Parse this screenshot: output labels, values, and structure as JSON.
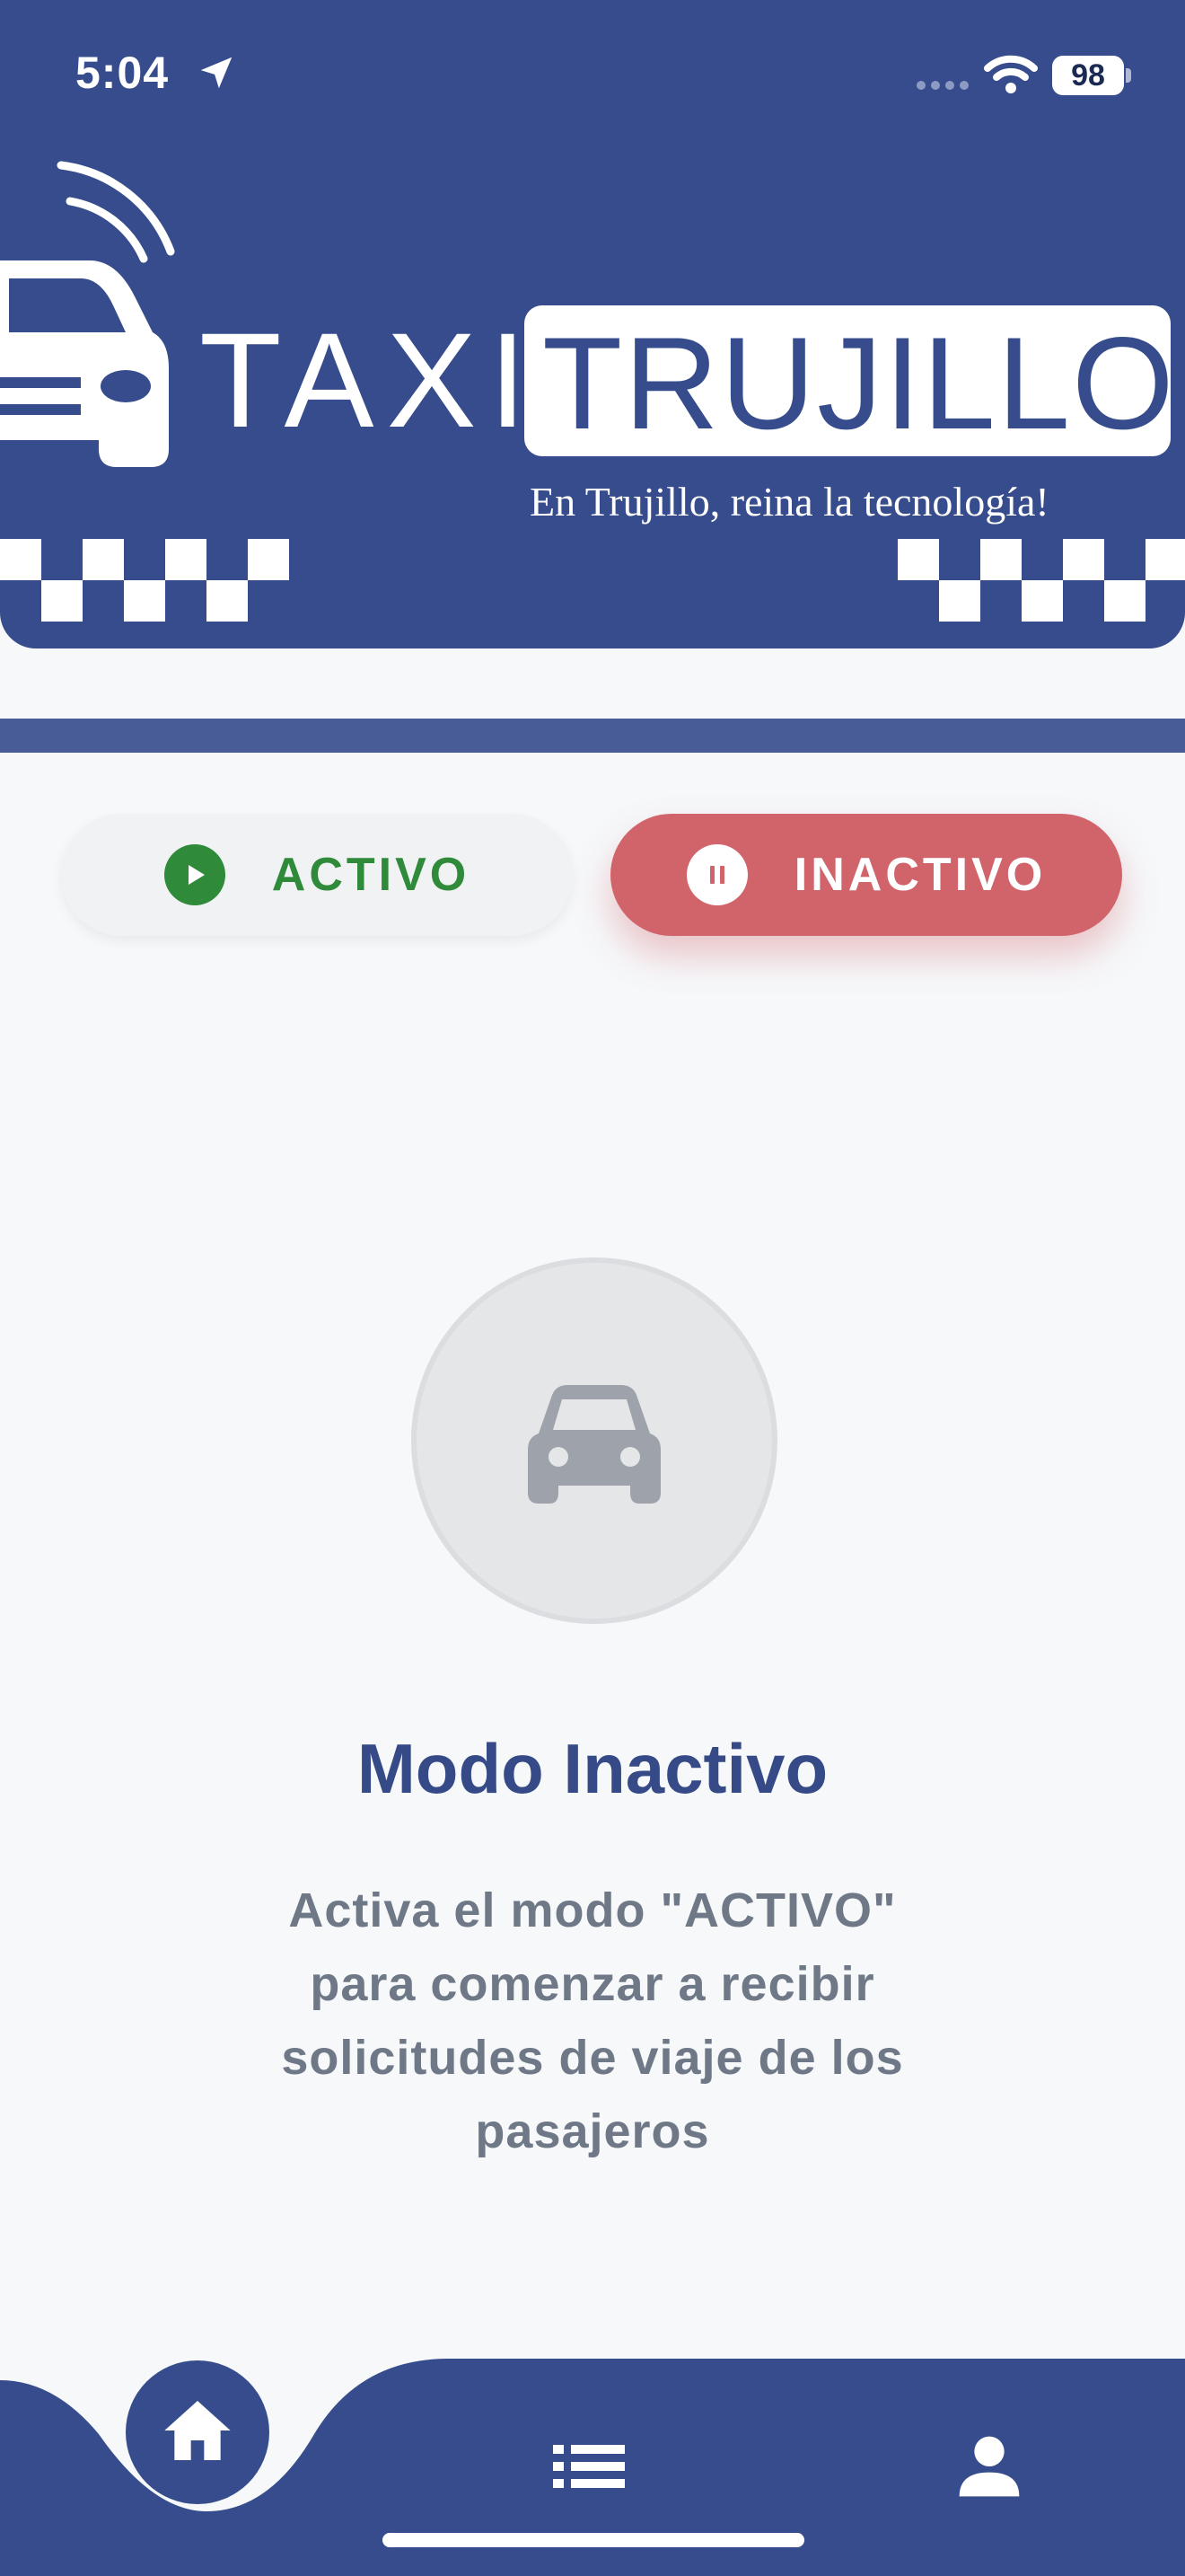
{
  "status_bar": {
    "time": "5:04",
    "battery": "98"
  },
  "brand": {
    "taxi": "TAXI",
    "trujillo": "TRUJILLO",
    "tagline": "En Trujillo, reina la tecnología!"
  },
  "toggle": {
    "active_label": "ACTIVO",
    "inactive_label": "INACTIVO",
    "selected": "INACTIVO"
  },
  "main": {
    "title": "Modo Inactivo",
    "description": "Activa el modo \"ACTIVO\" para comenzar a recibir solicitudes de viaje de los pasajeros"
  },
  "nav": {
    "items": [
      "home-icon",
      "list-icon",
      "profile-icon"
    ],
    "selected": "home-icon"
  },
  "colors": {
    "primary": "#374c8c",
    "active_green": "#2f8a3a",
    "inactive_red": "#d1636a",
    "muted_text": "#6f7886"
  }
}
